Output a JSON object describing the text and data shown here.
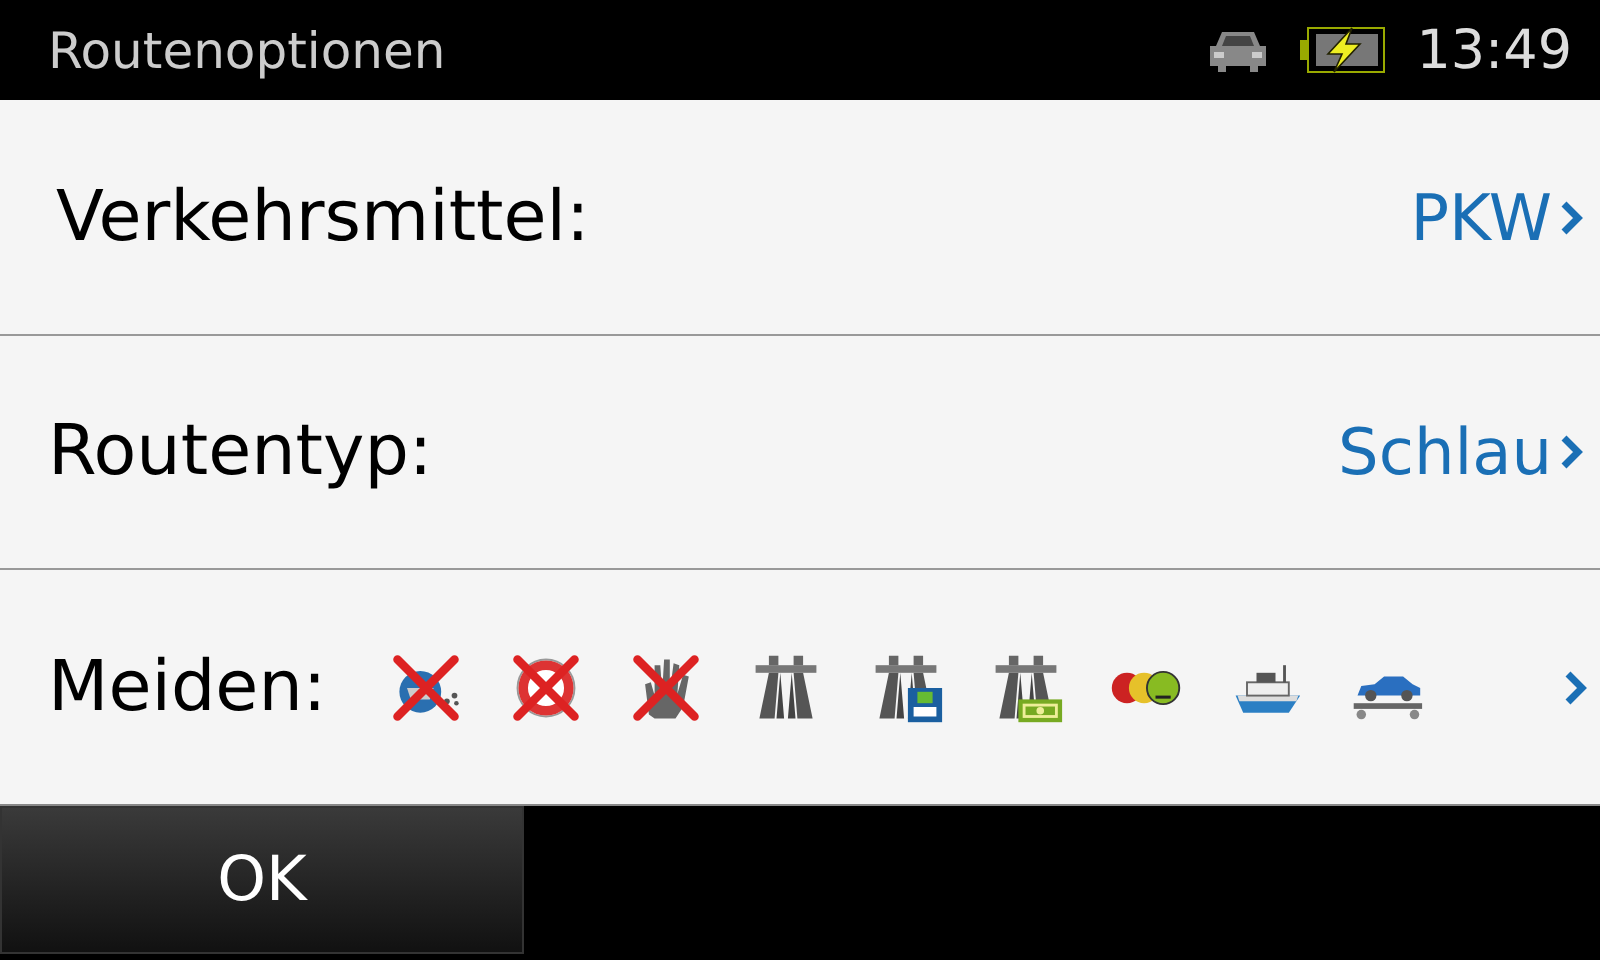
{
  "header": {
    "title": "Routenoptionen",
    "time": "13:49",
    "charging": true
  },
  "options": [
    {
      "label": "Verkehrsmittel:",
      "value": "PKW"
    },
    {
      "label": "Routentyp:",
      "value": "Schlau"
    }
  ],
  "avoid": {
    "label": "Meiden:",
    "items": [
      {
        "kind": "smog",
        "avoided": true
      },
      {
        "kind": "ring",
        "avoided": true
      },
      {
        "kind": "hand",
        "avoided": true
      },
      {
        "kind": "motorway",
        "avoided": false
      },
      {
        "kind": "federal",
        "avoided": false
      },
      {
        "kind": "toll",
        "avoided": false
      },
      {
        "kind": "coins",
        "avoided": false
      },
      {
        "kind": "ferry",
        "avoided": false
      },
      {
        "kind": "cartrain",
        "avoided": false
      }
    ]
  },
  "buttons": [
    {
      "label": "OK"
    }
  ]
}
